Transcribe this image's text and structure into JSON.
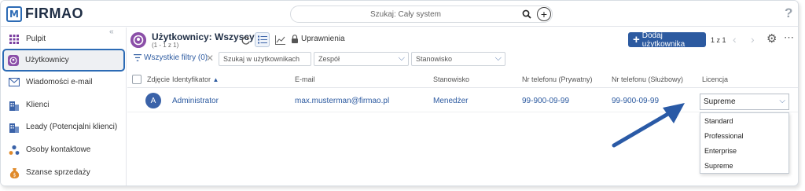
{
  "app": {
    "logo_mark": "M",
    "logo_text": "FIRMAO"
  },
  "topbar": {
    "search_placeholder": "Szukaj: Cały system",
    "help": "?"
  },
  "sidebar": {
    "collapse": "«",
    "items": [
      {
        "label": "Pulpit",
        "icon": "grid-icon"
      },
      {
        "label": "Użytkownicy",
        "icon": "users-icon",
        "active": true
      },
      {
        "label": "Wiadomości e-mail",
        "icon": "mail-icon"
      },
      {
        "label": "Klienci",
        "icon": "building-icon"
      },
      {
        "label": "Leady (Potencjalni klienci)",
        "icon": "building-icon"
      },
      {
        "label": "Osoby kontaktowe",
        "icon": "contacts-icon"
      },
      {
        "label": "Szanse sprzedaży",
        "icon": "money-bag-icon"
      }
    ]
  },
  "header": {
    "title": "Użytkownicy: Wszyscy",
    "subtitle": "(1 - 1 z 1)",
    "permissions": "Uprawnienia",
    "add_button": "Dodaj użytkownika",
    "pager": "1 z 1"
  },
  "filters": {
    "all_filters": "Wszystkie filtry (0)",
    "search_placeholder": "Szukaj w użytkownikach",
    "team": "Zespół",
    "position": "Stanowisko"
  },
  "table": {
    "columns": [
      "Zdjęcie",
      "Identyfikator",
      "E-mail",
      "Stanowisko",
      "Nr telefonu (Prywatny)",
      "Nr telefonu (Służbowy)",
      "Licencja"
    ],
    "rows": [
      {
        "avatar": "A",
        "identifier": "Administrator",
        "email": "max.musterman@firmao.pl",
        "position": "Menedżer",
        "phone_private": "99-900-09-99",
        "phone_work": "99-900-09-99",
        "license": "Supreme"
      }
    ]
  },
  "license_dropdown": {
    "options": [
      "Standard",
      "Professional",
      "Enterprise",
      "Supreme"
    ]
  },
  "colors": {
    "brand": "#2c5aa0",
    "accent_arrow": "#2a5aa6",
    "users_icon": "#8b4fa8"
  }
}
